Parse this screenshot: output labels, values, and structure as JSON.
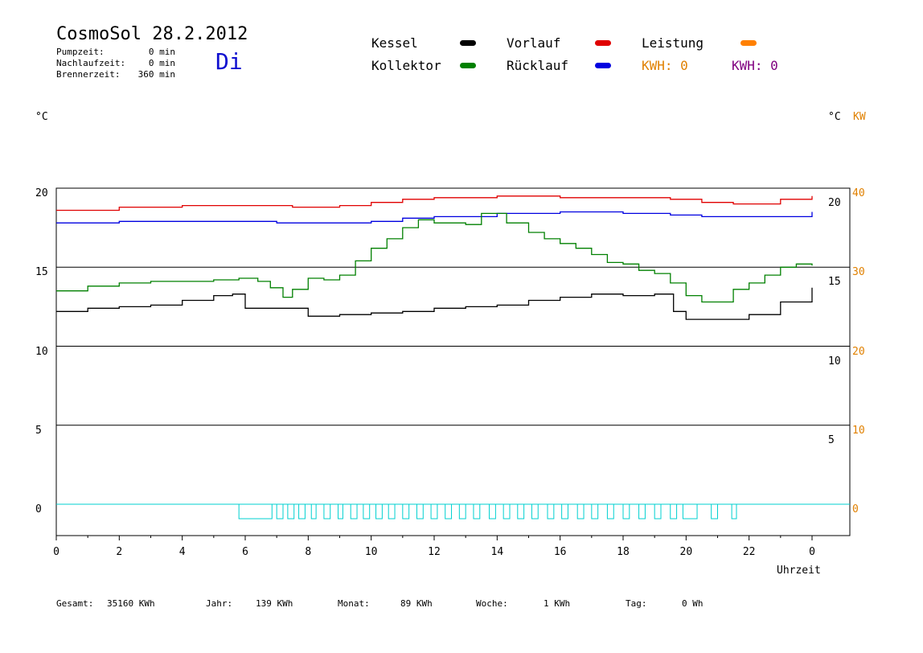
{
  "header": {
    "title": "CosmoSol 28.2.2012",
    "pump_label": "Pumpzeit:",
    "pump_value": "0 min",
    "nachlauf_label": "Nachlaufzeit:",
    "nachlauf_value": "0 min",
    "brenner_label": "Brennerzeit:",
    "brenner_value": "360 min",
    "day": "Di"
  },
  "legend": {
    "kessel": "Kessel",
    "kollektor": "Kollektor",
    "vorlauf": "Vorlauf",
    "ruecklauf": "Rücklauf",
    "leistung": "Leistung",
    "kwh1": "KWH: 0",
    "kwh2": "KWH: 0"
  },
  "axes": {
    "left_unit": "°C",
    "right_unit": "°C",
    "right_unit2": "KW",
    "x_title": "Uhrzeit",
    "left_ticks": [
      "20",
      "15",
      "10",
      "5",
      "0"
    ],
    "right_inner_ticks": [
      "20",
      "15",
      "10",
      "5"
    ],
    "right_outer_ticks": [
      "40",
      "30",
      "20",
      "10",
      "0"
    ],
    "x_ticks": [
      "0",
      "2",
      "4",
      "6",
      "8",
      "10",
      "12",
      "14",
      "16",
      "18",
      "20",
      "22",
      "0"
    ]
  },
  "footer": {
    "gesamt_label": "Gesamt:",
    "gesamt_value": "35160 KWh",
    "jahr_label": "Jahr:",
    "jahr_value": "139 KWh",
    "monat_label": "Monat:",
    "monat_value": "89 KWh",
    "woche_label": "Woche:",
    "woche_value": "1 KWh",
    "tag_label": "Tag:",
    "tag_value": "0 Wh"
  },
  "colors": {
    "kessel": "#000000",
    "kollektor": "#008000",
    "vorlauf": "#e00000",
    "ruecklauf": "#0000e0",
    "leistung": "#ff8000",
    "kwh2": "#800080",
    "pump": "#00d0d0"
  },
  "chart_data": {
    "type": "line",
    "title": "CosmoSol 28.2.2012",
    "xlabel": "Uhrzeit",
    "ylabel": "°C",
    "xlim": [
      0,
      24
    ],
    "ylim": [
      -2,
      20.5
    ],
    "grid": true,
    "series": [
      {
        "name": "Vorlauf",
        "color": "#e00000",
        "x": [
          0,
          2,
          4,
          6,
          7.5,
          9,
          10,
          11,
          12,
          13,
          14,
          16,
          18,
          19.5,
          20.5,
          21.5,
          23,
          24
        ],
        "y": [
          18.6,
          18.8,
          18.9,
          18.9,
          18.8,
          18.9,
          19.1,
          19.3,
          19.4,
          19.4,
          19.5,
          19.4,
          19.4,
          19.3,
          19.1,
          19.0,
          19.3,
          19.5
        ]
      },
      {
        "name": "Rücklauf",
        "color": "#0000e0",
        "x": [
          0,
          2,
          4,
          6,
          7,
          9,
          10,
          11,
          12,
          14,
          16,
          18,
          19.5,
          20.5,
          22,
          24
        ],
        "y": [
          17.8,
          17.9,
          17.9,
          17.9,
          17.8,
          17.8,
          17.9,
          18.1,
          18.2,
          18.4,
          18.5,
          18.4,
          18.3,
          18.2,
          18.2,
          18.5
        ]
      },
      {
        "name": "Kollektor",
        "color": "#008000",
        "x": [
          0,
          1,
          2,
          3,
          4,
          5,
          5.8,
          6.4,
          6.8,
          7.2,
          7.5,
          8,
          8.5,
          9,
          9.5,
          10,
          10.5,
          11,
          11.5,
          12,
          12.5,
          13,
          13.5,
          13.8,
          14.3,
          15,
          15.5,
          16,
          16.5,
          17,
          17.5,
          18,
          18.5,
          19,
          19.5,
          20,
          20.5,
          21,
          21.5,
          22,
          22.5,
          23,
          23.5,
          24
        ],
        "y": [
          13.5,
          13.8,
          14.0,
          14.1,
          14.1,
          14.2,
          14.3,
          14.1,
          13.7,
          13.1,
          13.6,
          14.3,
          14.2,
          14.5,
          15.4,
          16.2,
          16.8,
          17.5,
          18.0,
          17.8,
          17.8,
          17.7,
          18.4,
          18.4,
          17.8,
          17.2,
          16.8,
          16.5,
          16.2,
          15.8,
          15.3,
          15.2,
          14.8,
          14.6,
          14.0,
          13.2,
          12.8,
          12.8,
          13.6,
          14.0,
          14.5,
          15.0,
          15.2,
          15.1
        ]
      },
      {
        "name": "Kessel",
        "color": "#000000",
        "x": [
          0,
          1,
          2,
          3,
          4,
          5,
          5.6,
          6,
          7,
          7.8,
          8,
          9,
          10,
          11,
          12,
          13,
          14,
          15,
          16,
          17,
          18,
          19,
          19.6,
          20,
          21,
          22,
          23,
          24
        ],
        "y": [
          12.2,
          12.4,
          12.5,
          12.6,
          12.9,
          13.2,
          13.3,
          12.4,
          12.4,
          12.4,
          11.9,
          12.0,
          12.1,
          12.2,
          12.4,
          12.5,
          12.6,
          12.9,
          13.1,
          13.3,
          13.2,
          13.3,
          12.2,
          11.7,
          11.7,
          12.0,
          12.8,
          13.7
        ]
      }
    ],
    "pump_intervals_h": [
      [
        5.8,
        6.85
      ],
      [
        7.0,
        7.2
      ],
      [
        7.35,
        7.55
      ],
      [
        7.7,
        7.9
      ],
      [
        8.1,
        8.25
      ],
      [
        8.5,
        8.7
      ],
      [
        8.95,
        9.1
      ],
      [
        9.35,
        9.55
      ],
      [
        9.75,
        9.95
      ],
      [
        10.15,
        10.35
      ],
      [
        10.55,
        10.75
      ],
      [
        11.0,
        11.2
      ],
      [
        11.45,
        11.65
      ],
      [
        11.9,
        12.1
      ],
      [
        12.35,
        12.55
      ],
      [
        12.8,
        13.0
      ],
      [
        13.25,
        13.45
      ],
      [
        13.75,
        13.95
      ],
      [
        14.2,
        14.4
      ],
      [
        14.65,
        14.85
      ],
      [
        15.1,
        15.3
      ],
      [
        15.6,
        15.8
      ],
      [
        16.05,
        16.25
      ],
      [
        16.55,
        16.75
      ],
      [
        17.0,
        17.2
      ],
      [
        17.5,
        17.7
      ],
      [
        18.0,
        18.2
      ],
      [
        18.5,
        18.7
      ],
      [
        19.0,
        19.2
      ],
      [
        19.5,
        19.7
      ],
      [
        19.9,
        20.35
      ],
      [
        20.8,
        21.0
      ],
      [
        21.45,
        21.6
      ]
    ]
  }
}
